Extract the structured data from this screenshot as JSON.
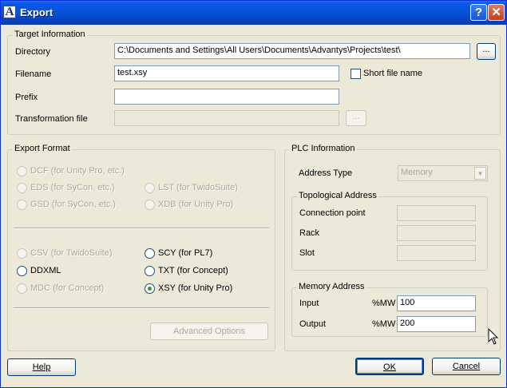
{
  "window": {
    "app_icon": "A",
    "title": "Export",
    "help_glyph": "?",
    "close_glyph": "✕"
  },
  "target": {
    "group_title": "Target Information",
    "directory_label": "Directory",
    "directory_value": "C:\\Documents and Settings\\All Users\\Documents\\Advantys\\Projects\\test\\",
    "browse_label": "...",
    "filename_label": "Filename",
    "filename_value": "test.xsy",
    "short_name_label": "Short file name",
    "prefix_label": "Prefix",
    "prefix_value": "",
    "transformation_label": "Transformation file",
    "transformation_value": "",
    "transformation_browse_label": "..."
  },
  "export_format": {
    "group_title": "Export Format",
    "dcf": "DCF (for Unity Pro, etc.)",
    "eds": "EDS (for SyCon, etc.)",
    "lst": "LST (for TwidoSuite)",
    "gsd": "GSD (for SyCon, etc.)",
    "xdb": "XDB (for Unity Pro)",
    "csv": "CSV (for TwidoSuite)",
    "scy": "SCY (for PL7)",
    "ddxml": "DDXML",
    "txt": "TXT (for Concept)",
    "mdc": "MDC (for Concept)",
    "xsy": "XSY (for Unity Pro)",
    "advanced_options": "Advanced Options",
    "selected": "xsy"
  },
  "plc": {
    "group_title": "PLC Information",
    "address_type_label": "Address Type",
    "address_type_value": "Memory",
    "topological": {
      "group_title": "Topological Address",
      "connection_point_label": "Connection point",
      "rack_label": "Rack",
      "slot_label": "Slot"
    },
    "memory": {
      "group_title": "Memory Address",
      "input_label": "Input",
      "input_prefix": "%MW",
      "input_value": "100",
      "output_label": "Output",
      "output_prefix": "%MW",
      "output_value": "200"
    }
  },
  "footer": {
    "help_button": "Help",
    "ok_button": "OK",
    "cancel_button": "Cancel"
  }
}
